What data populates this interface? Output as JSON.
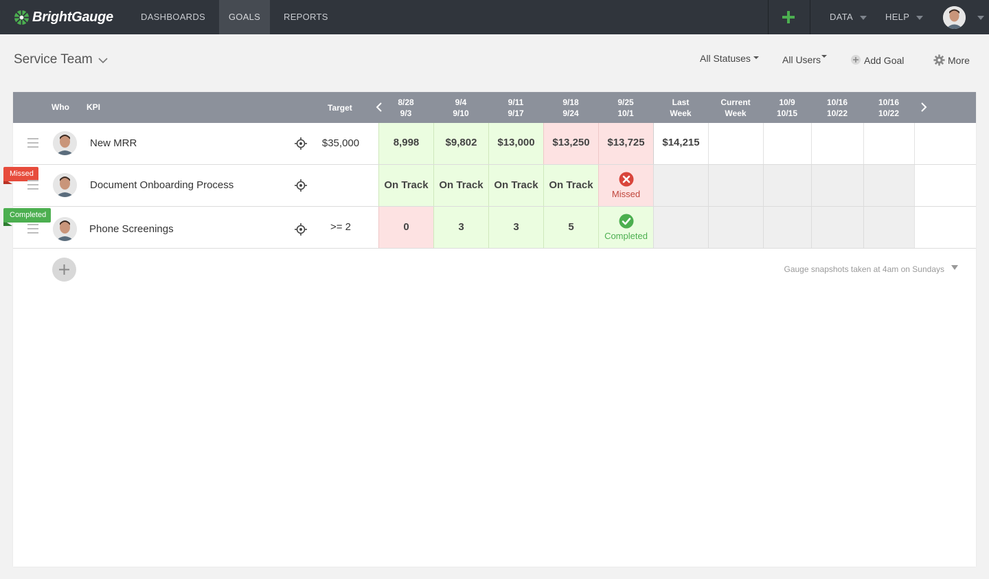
{
  "app": {
    "brand": "BrightGauge"
  },
  "nav": {
    "items": [
      {
        "label": "DASHBOARDS"
      },
      {
        "label": "GOALS",
        "active": true
      },
      {
        "label": "REPORTS"
      }
    ],
    "right": {
      "data_label": "DATA",
      "help_label": "HELP"
    }
  },
  "colors": {
    "accent": "#4caf50",
    "missed": "#e74c3c",
    "header_bg": "#30353c",
    "table_header": "#8c919b"
  },
  "page": {
    "title": "Service Team",
    "actions": {
      "statuses": "All Statuses",
      "users": "All Users",
      "add_goal": "Add Goal",
      "more": "More"
    }
  },
  "table": {
    "headers": {
      "who": "Who",
      "kpi": "KPI",
      "target": "Target",
      "weeks": [
        [
          "8/28",
          "9/3"
        ],
        [
          "9/4",
          "9/10"
        ],
        [
          "9/11",
          "9/17"
        ],
        [
          "9/18",
          "9/24"
        ],
        [
          "9/25",
          "10/1"
        ],
        [
          "Last",
          "Week"
        ],
        [
          "Current",
          "Week"
        ],
        [
          "10/9",
          "10/15"
        ],
        [
          "10/16",
          "10/22"
        ],
        [
          "10/16",
          "10/22"
        ]
      ]
    },
    "rows": [
      {
        "kpi": "New MRR",
        "target": "$35,000",
        "flag": "",
        "cells": [
          "8,998",
          "$9,802",
          "$13,000",
          "$13,250",
          "$13,725",
          "$14,215",
          "",
          "",
          "",
          ""
        ]
      },
      {
        "kpi": "Document Onboarding Process",
        "target": "",
        "flag": "Missed",
        "cells": [
          "On Track",
          "On Track",
          "On Track",
          "On Track",
          "Missed",
          "",
          "",
          "",
          "",
          ""
        ]
      },
      {
        "kpi": "Phone Screenings",
        "target": ">= 2",
        "flag": "Completed",
        "cells": [
          "0",
          "3",
          "3",
          "5",
          "Completed",
          "",
          "",
          "",
          "",
          ""
        ]
      }
    ],
    "footer_note": "Gauge snapshots taken at 4am on Sundays"
  }
}
